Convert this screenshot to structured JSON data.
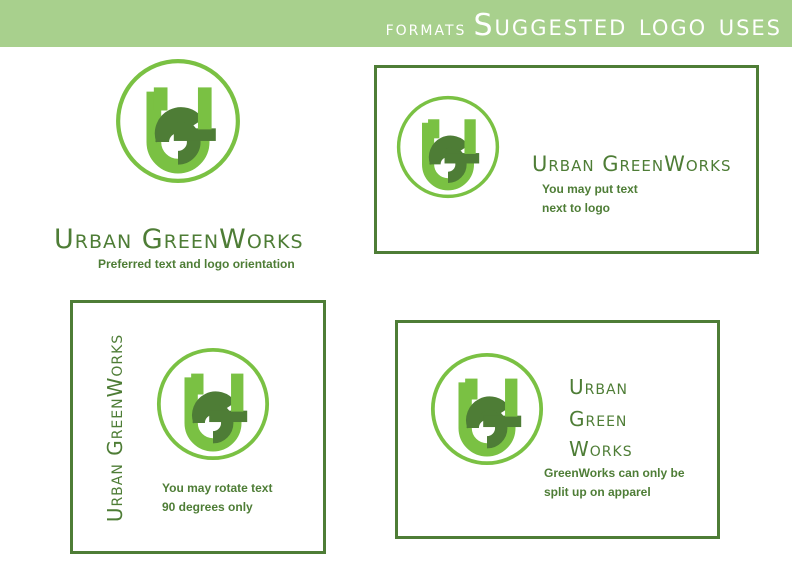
{
  "header": {
    "prefix": "formats",
    "title": "Suggested logo uses"
  },
  "brand": {
    "name": "Urban GreenWorks",
    "split": [
      "Urban",
      "Green",
      "Works"
    ]
  },
  "notes": {
    "primary": "Preferred text and logo orientation",
    "side": [
      "You may put text",
      "next to logo"
    ],
    "rotate": [
      "You may rotate text",
      "90 degrees only"
    ],
    "split": [
      "GreenWorks can only be",
      "split up on apparel"
    ]
  },
  "colors": {
    "header_bg": "#a8d08d",
    "light_green": "#7ac143",
    "dark_green": "#4e7d36",
    "text_green": "#4e7d36"
  }
}
